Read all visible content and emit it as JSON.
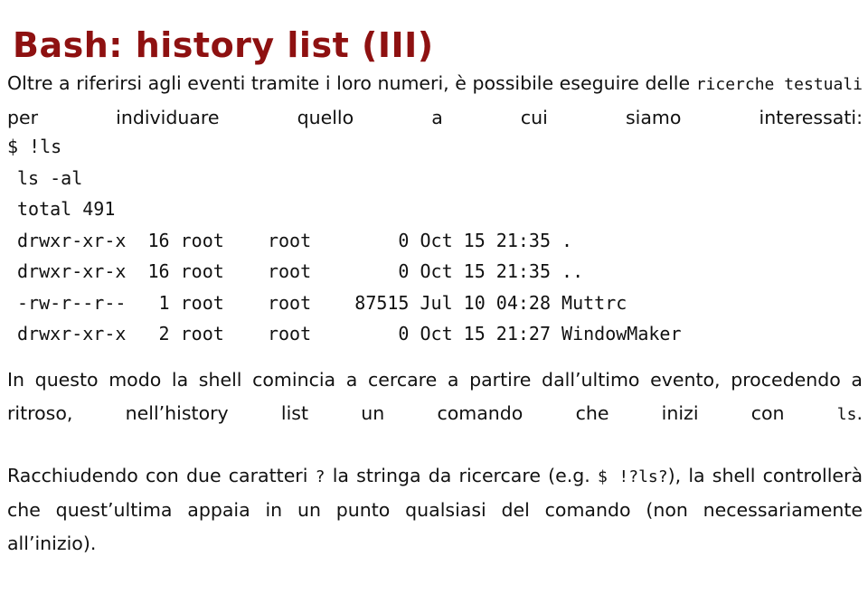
{
  "slide": {
    "title": "Bash: history list (III)",
    "title_color": "#8e1111",
    "background_color": "#ffffff",
    "text_color": "#111111"
  },
  "intro": {
    "part1": "Oltre a riferirsi agli eventi tramite i loro numeri, è possibile eseguire delle ",
    "mono1": "ricerche testuali",
    "part2": " per individuare quello a cui siamo interessati:"
  },
  "terminal": {
    "lines": [
      "$ !ls",
      "ls -al",
      "total 491",
      "drwxr-xr-x  16 root    root        0 Oct 15 21:35 .",
      "drwxr-xr-x  16 root    root        0 Oct 15 21:35 ..",
      "-rw-r--r--   1 root    root    87515 Jul 10 04:28 Muttrc",
      "drwxr-xr-x   2 root    root        0 Oct 15 21:27 WindowMaker"
    ],
    "prompt_line": "$ !ls",
    "command_echo": "ls -al",
    "total_line": "total 491",
    "listing": [
      {
        "permissions": "drwxr-xr-x",
        "links": "16",
        "owner": "root",
        "group": "root",
        "size": "0",
        "month": "Oct",
        "day": "15",
        "time": "21:35",
        "name": "."
      },
      {
        "permissions": "drwxr-xr-x",
        "links": "16",
        "owner": "root",
        "group": "root",
        "size": "0",
        "month": "Oct",
        "day": "15",
        "time": "21:35",
        "name": ".."
      },
      {
        "permissions": "-rw-r--r--",
        "links": "1",
        "owner": "root",
        "group": "root",
        "size": "87515",
        "month": "Jul",
        "day": "10",
        "time": "04:28",
        "name": "Muttrc"
      },
      {
        "permissions": "drwxr-xr-x",
        "links": "2",
        "owner": "root",
        "group": "root",
        "size": "0",
        "month": "Oct",
        "day": "15",
        "time": "21:27",
        "name": "WindowMaker"
      }
    ]
  },
  "middle": {
    "part1": "In questo modo la shell comincia a cercare a partire dall’ultimo evento, procedendo a ritroso, nell’history list un comando che inizi con ",
    "mono1": "ls",
    "part2": "."
  },
  "final": {
    "part1": "Racchiudendo con due caratteri ",
    "mono1": "?",
    "part2": " la stringa da ricercare (e.g. ",
    "mono2": "$ !?ls?",
    "part3": "), la shell controllerà che quest’ultima appaia in un punto qualsiasi del comando (non necessariamente all’inizio)."
  }
}
